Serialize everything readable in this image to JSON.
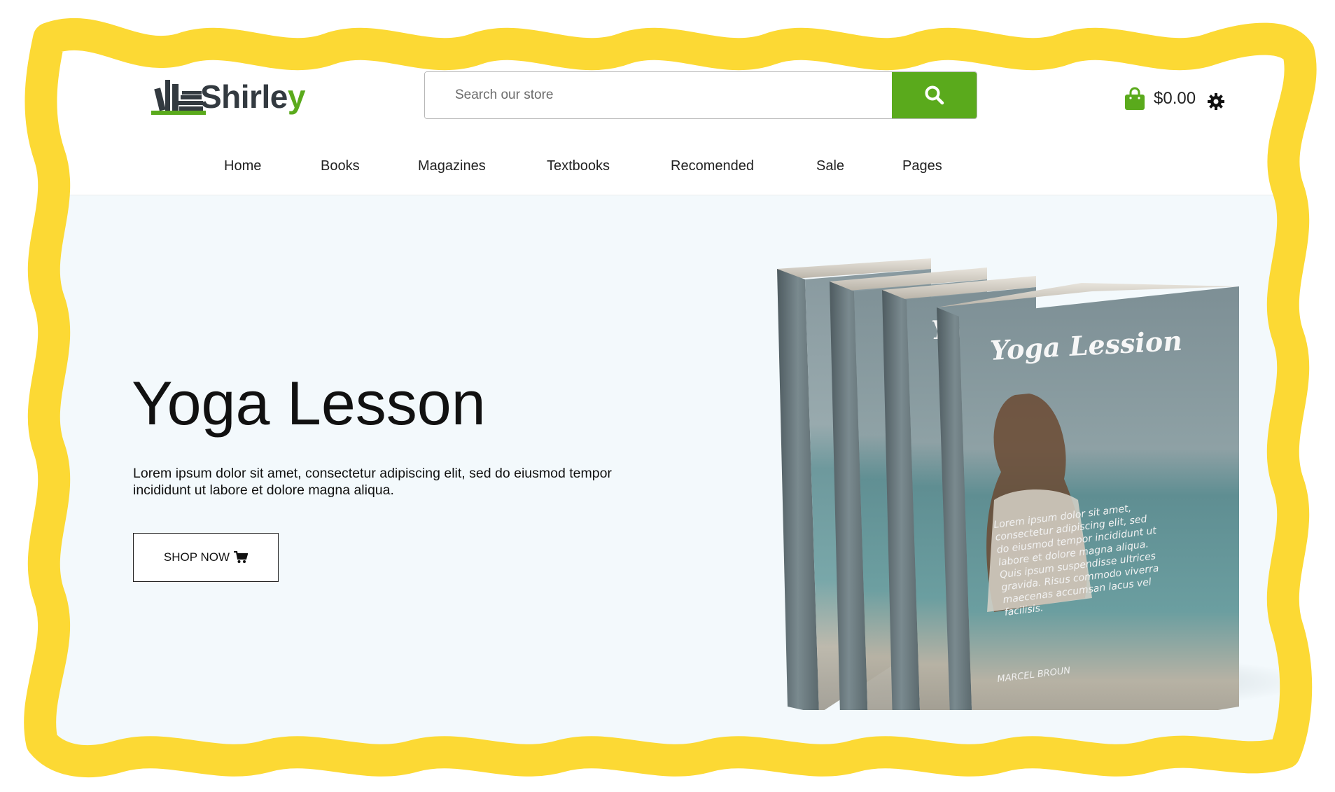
{
  "header": {
    "brand": {
      "main": "Shirle",
      "accent": "y"
    },
    "search": {
      "placeholder": "Search our store"
    },
    "cart_total": "$0.00"
  },
  "nav": {
    "items": [
      "Home",
      "Books",
      "Magazines",
      "Textbooks",
      "Recomended",
      "Sale",
      "Pages"
    ]
  },
  "hero": {
    "title": "Yoga Lesson",
    "description_line1": "Lorem ipsum dolor sit amet, consectetur adipiscing elit, sed do eiusmod tempor",
    "description_line2": "incididunt ut labore et dolore magna aliqua.",
    "button_label": "SHOP NOW"
  },
  "book_cover": {
    "title": "Yoga Lession",
    "spine_partial": "Yo",
    "body": [
      "Lorem ipsum dolor sit amet,",
      "consectetur adipiscing elit, sed",
      "do eiusmod tempor incididunt ut",
      "labore et dolore magna aliqua.",
      "Quis ipsum suspendisse ultrices",
      "gravida. Risus commodo viverra",
      "maecenas accumsan lacus vel",
      "facilisis."
    ],
    "author": "MARCEL BROUN"
  },
  "colors": {
    "accent": "#5aaa1c",
    "frame": "#fcd934",
    "hero_bg": "#f3f9fc"
  },
  "icons": {
    "logo": "books-stack-icon",
    "search": "search-icon",
    "cart": "shopping-bag-icon",
    "settings": "gear-icon",
    "shop_cart": "cart-icon"
  }
}
